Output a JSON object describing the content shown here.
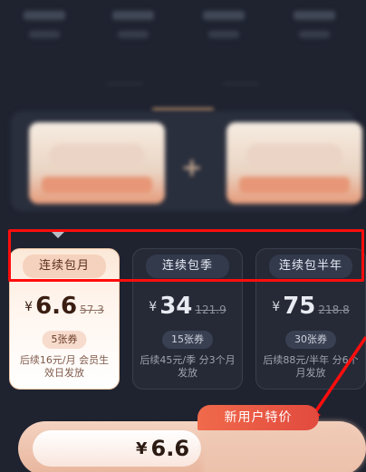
{
  "plans": [
    {
      "name": "连续包月",
      "currency": "¥",
      "price": "6.6",
      "original": "57.3",
      "tickets": "5张券",
      "note": "后续16元/月 会员生效日发放",
      "active": true
    },
    {
      "name": "连续包季",
      "currency": "¥",
      "price": "34",
      "original": "121.9",
      "tickets": "15张券",
      "note": "后续45元/季 分3个月发放",
      "active": false
    },
    {
      "name": "连续包半年",
      "currency": "¥",
      "price": "75",
      "original": "218.8",
      "tickets": "30张券",
      "note": "后续88元/半年 分6个月发放",
      "active": false
    }
  ],
  "badge": "新用户特价",
  "cta": {
    "currency": "¥",
    "amount": "6.6"
  },
  "colors": {
    "highlight": "#ff0d0d",
    "badge": "#e24a3e",
    "background": "#1f2330"
  }
}
